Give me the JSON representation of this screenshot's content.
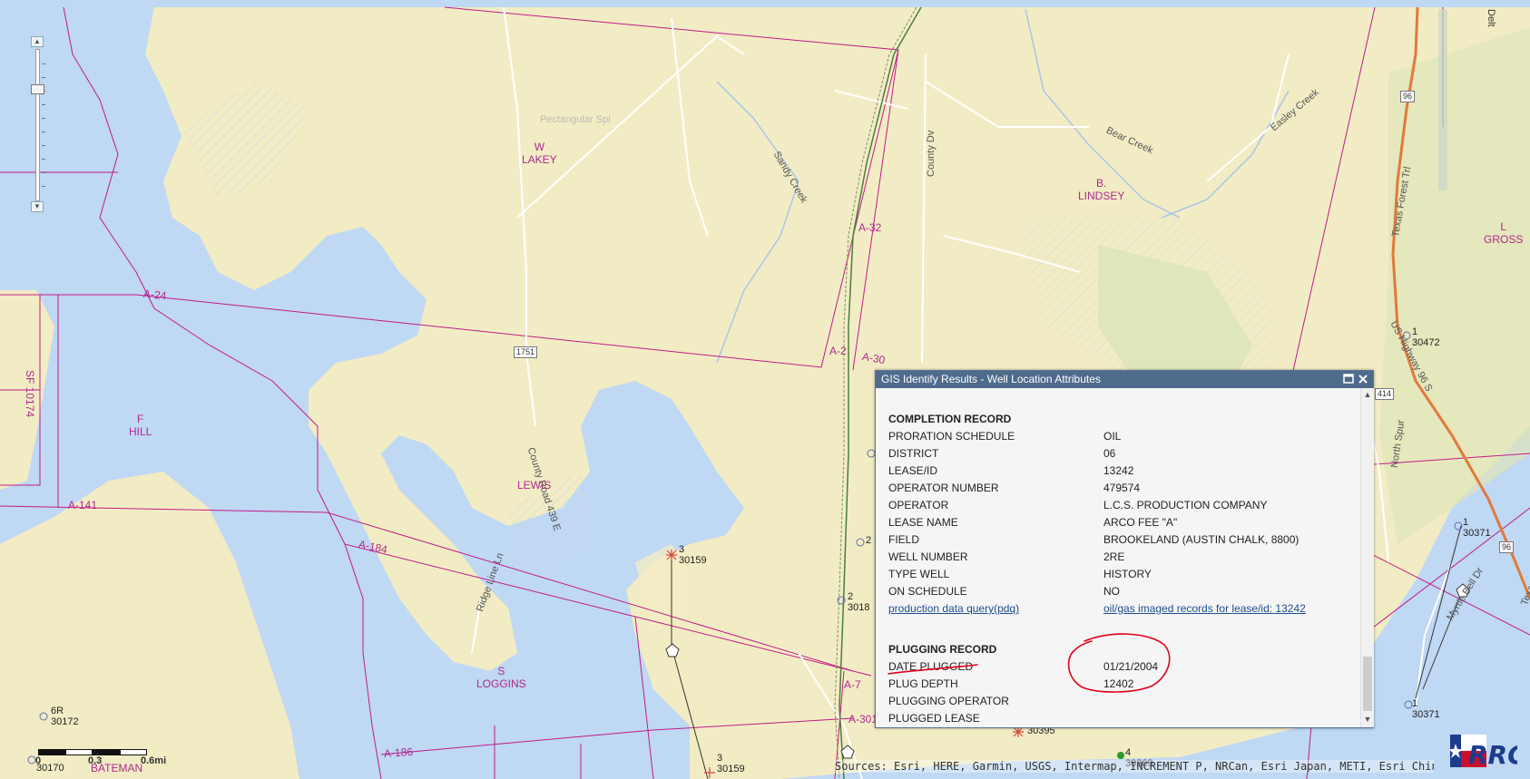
{
  "map": {
    "colors": {
      "water": "#bfd8f3",
      "land": "#f2ecc4",
      "boundary": "#c21a8a",
      "road": "#ffffff",
      "highway": "#e07a3c"
    },
    "survey_labels": [
      {
        "id": "w-lakey",
        "line1": "W",
        "line2": "LAKEY"
      },
      {
        "id": "b-lindsey",
        "line1": "B.",
        "line2": "LINDSEY"
      },
      {
        "id": "f-hill",
        "line1": "F",
        "line2": "HILL"
      },
      {
        "id": "lewis",
        "line1": "LEWIS",
        "line2": ""
      },
      {
        "id": "s-loggins",
        "line1": "S",
        "line2": "LOGGINS"
      },
      {
        "id": "l-gross",
        "line1": "L",
        "line2": "GROSS"
      },
      {
        "id": "bateman",
        "line1": "BATEMAN",
        "line2": ""
      }
    ],
    "abstract_labels": [
      "A-24",
      "A-141",
      "A-184",
      "A-186",
      "A-32",
      "A-30",
      "A-2",
      "A-301",
      "A-7",
      "SF 10174"
    ],
    "road_labels": [
      "County Dv",
      "Sandy Creek",
      "Bear Creek",
      "Easley Creek",
      "County Road 439 E",
      "Ridge Line Ln",
      "North Spur",
      "Texas Forest Trl",
      "US Highway 96 S",
      "Myrtle Bell Dr",
      "Texas Fore",
      "Pectangular Spi"
    ],
    "shields": [
      "1751",
      "96",
      "414",
      "96"
    ],
    "wells": [
      {
        "num": "3",
        "api": "30159"
      },
      {
        "num": "1",
        "api": "30472"
      },
      {
        "num": "1",
        "api": "30371"
      },
      {
        "num": "1",
        "api": "30371"
      },
      {
        "num": "6R",
        "api": "30172"
      },
      {
        "num": "",
        "api": "30170"
      },
      {
        "num": "3",
        "api": "30159"
      },
      {
        "num": "",
        "api": "30395"
      },
      {
        "num": "4",
        "api": "30369"
      },
      {
        "num": "2",
        "api": "3018"
      },
      {
        "num": "2",
        "api": ""
      }
    ],
    "scale": {
      "ticks": [
        "0",
        "0.3",
        "0.6mi"
      ]
    },
    "attribution": "Sources: Esri, HERE, Garmin, USGS, Intermap, INCREMENT P, NRCan, Esri Japan, METI, Esri China (Hong Kong),",
    "logo_text": "RRC",
    "corner_labels": [
      "Delt"
    ]
  },
  "popup": {
    "title": "GIS Identify Results - Well Location Attributes",
    "completion_heading": "COMPLETION RECORD",
    "completion": [
      {
        "k": "PRORATION SCHEDULE",
        "v": "OIL"
      },
      {
        "k": "DISTRICT",
        "v": "06"
      },
      {
        "k": "LEASE/ID",
        "v": "13242"
      },
      {
        "k": "OPERATOR NUMBER",
        "v": "479574"
      },
      {
        "k": "OPERATOR",
        "v": "L.C.S. PRODUCTION COMPANY"
      },
      {
        "k": "LEASE NAME",
        "v": "ARCO FEE \"A\""
      },
      {
        "k": "FIELD",
        "v": "BROOKELAND (AUSTIN CHALK, 8800)"
      },
      {
        "k": "WELL NUMBER",
        "v": "2RE"
      },
      {
        "k": "TYPE WELL",
        "v": "HISTORY"
      },
      {
        "k": "ON SCHEDULE",
        "v": "NO"
      }
    ],
    "links": {
      "pdq": "production data query(pdq)",
      "imaged": "oil/gas imaged records for lease/id: 13242"
    },
    "plugging_heading": "PLUGGING RECORD",
    "plugging": [
      {
        "k": "DATE PLUGGED",
        "v": "01/21/2004"
      },
      {
        "k": "PLUG DEPTH",
        "v": "12402"
      },
      {
        "k": "PLUGGING OPERATOR",
        "v": ""
      },
      {
        "k": "PLUGGED LEASE",
        "v": ""
      }
    ],
    "annotation_color": "#e0001b"
  }
}
